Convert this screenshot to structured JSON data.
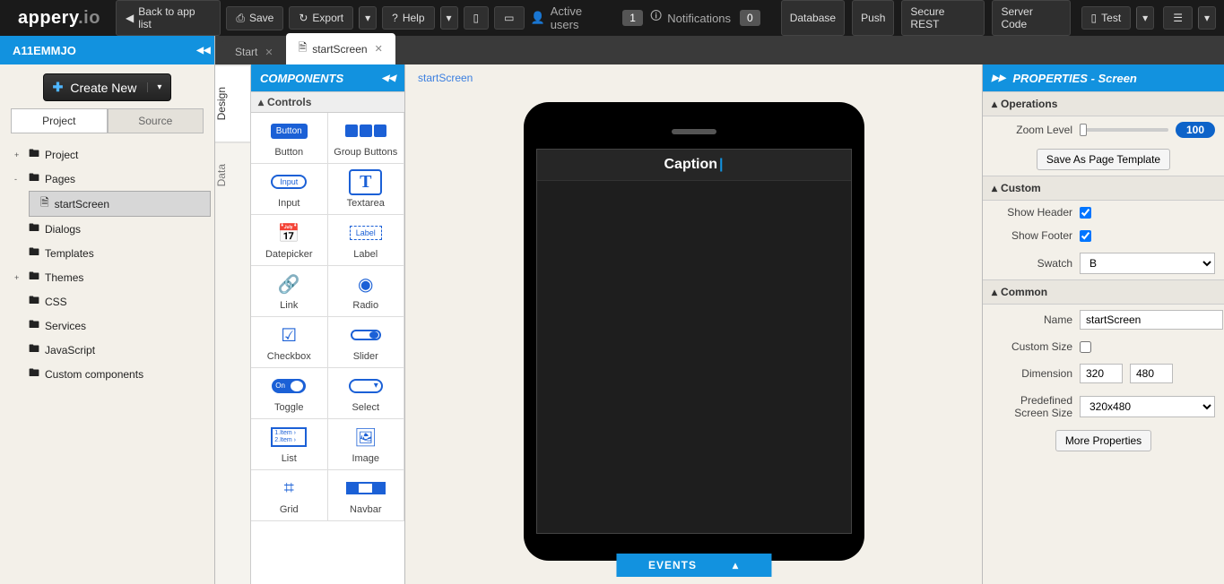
{
  "logo": {
    "brand": "appery",
    "suffix": ".io"
  },
  "topbar": {
    "back": "Back to app list",
    "save": "Save",
    "export": "Export",
    "help": "Help",
    "active_users_label": "Active users",
    "active_users_count": "1",
    "notifications_label": "Notifications",
    "notifications_count": "0",
    "links": [
      "Database",
      "Push",
      "Secure REST",
      "Server Code"
    ],
    "test": "Test"
  },
  "sidebar": {
    "project_name": "A11EMMJO",
    "create_new": "Create New",
    "tabs": [
      "Project",
      "Source"
    ],
    "tree": [
      {
        "label": "Project",
        "expand": "+"
      },
      {
        "label": "Pages",
        "expand": "-",
        "children": [
          {
            "label": "startScreen"
          }
        ]
      },
      {
        "label": "Dialogs"
      },
      {
        "label": "Templates"
      },
      {
        "label": "Themes",
        "expand": "+"
      },
      {
        "label": "CSS"
      },
      {
        "label": "Services"
      },
      {
        "label": "JavaScript"
      },
      {
        "label": "Custom components"
      }
    ]
  },
  "tabs": {
    "start": "Start",
    "current": "startScreen"
  },
  "vtabs": [
    "Design",
    "Data"
  ],
  "palette": {
    "title": "COMPONENTS",
    "section": "Controls",
    "items": [
      "Button",
      "Group Buttons",
      "Input",
      "Textarea",
      "Datepicker",
      "Label",
      "Link",
      "Radio",
      "Checkbox",
      "Slider",
      "Toggle",
      "Select",
      "List",
      "Image",
      "Grid",
      "Navbar"
    ]
  },
  "canvas": {
    "crumb": "startScreen",
    "caption": "Caption",
    "events": "EVENTS"
  },
  "props": {
    "title": "PROPERTIES - Screen",
    "sections": {
      "operations": "Operations",
      "custom": "Custom",
      "common": "Common"
    },
    "operations": {
      "zoom_label": "Zoom Level",
      "zoom_value": "100",
      "save_template": "Save As Page Template"
    },
    "custom": {
      "show_header": "Show Header",
      "show_footer": "Show Footer",
      "swatch_label": "Swatch",
      "swatch_value": "B"
    },
    "common": {
      "name_label": "Name",
      "name_value": "startScreen",
      "custom_size_label": "Custom Size",
      "dimension_label": "Dimension",
      "dim_w": "320",
      "dim_h": "480",
      "predefined_label": "Predefined Screen Size",
      "predefined_value": "320x480",
      "more": "More Properties"
    }
  }
}
